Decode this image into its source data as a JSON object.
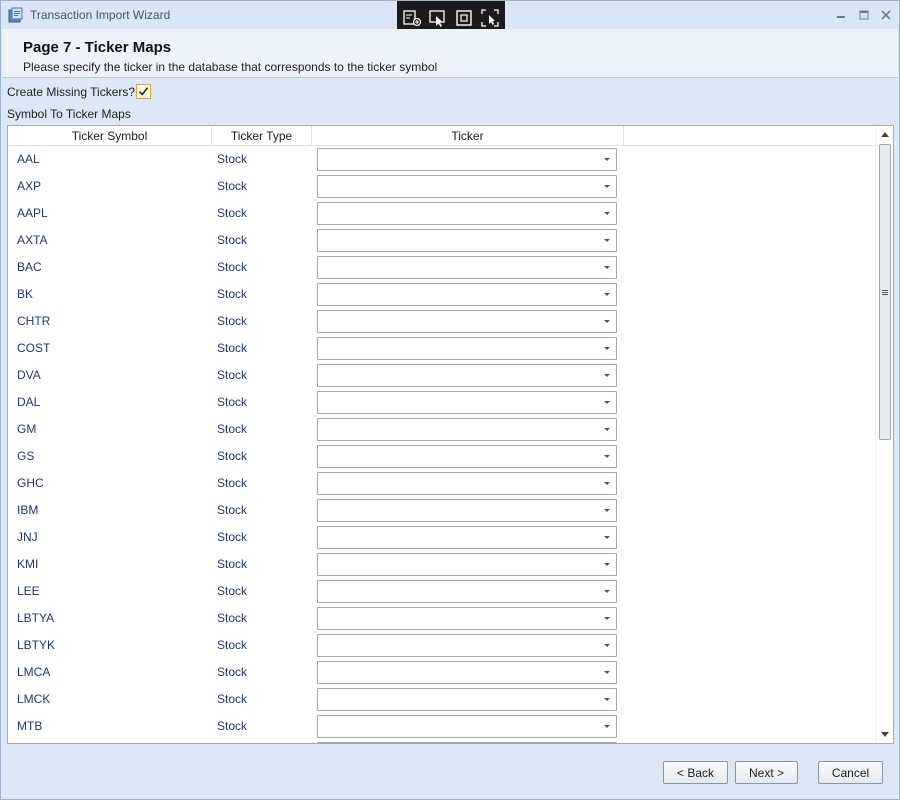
{
  "window": {
    "title": "Transaction Import Wizard",
    "app_icon": "wizard-app-icon",
    "controls": [
      "minimize-icon",
      "maximize-icon",
      "close-icon"
    ]
  },
  "floating_toolbar": {
    "icons": [
      "add-region-icon",
      "select-pointer-icon",
      "frame-icon",
      "screenshot-icon"
    ]
  },
  "header": {
    "title": "Page 7 - Ticker Maps",
    "subtitle": "Please specify the ticker in the database that corresponds to the ticker symbol"
  },
  "create_missing": {
    "label": "Create Missing Tickers?",
    "checked": true
  },
  "grid": {
    "section_label": "Symbol To Ticker Maps",
    "columns": [
      "Ticker Symbol",
      "Ticker Type",
      "Ticker"
    ],
    "rows": [
      {
        "symbol": "AAL",
        "type": "Stock",
        "ticker": ""
      },
      {
        "symbol": "AXP",
        "type": "Stock",
        "ticker": ""
      },
      {
        "symbol": "AAPL",
        "type": "Stock",
        "ticker": ""
      },
      {
        "symbol": "AXTA",
        "type": "Stock",
        "ticker": ""
      },
      {
        "symbol": "BAC",
        "type": "Stock",
        "ticker": ""
      },
      {
        "symbol": "BK",
        "type": "Stock",
        "ticker": ""
      },
      {
        "symbol": "CHTR",
        "type": "Stock",
        "ticker": ""
      },
      {
        "symbol": "COST",
        "type": "Stock",
        "ticker": ""
      },
      {
        "symbol": "DVA",
        "type": "Stock",
        "ticker": ""
      },
      {
        "symbol": "DAL",
        "type": "Stock",
        "ticker": ""
      },
      {
        "symbol": "GM",
        "type": "Stock",
        "ticker": ""
      },
      {
        "symbol": "GS",
        "type": "Stock",
        "ticker": ""
      },
      {
        "symbol": "GHC",
        "type": "Stock",
        "ticker": ""
      },
      {
        "symbol": "IBM",
        "type": "Stock",
        "ticker": ""
      },
      {
        "symbol": "JNJ",
        "type": "Stock",
        "ticker": ""
      },
      {
        "symbol": "KMI",
        "type": "Stock",
        "ticker": ""
      },
      {
        "symbol": "LEE",
        "type": "Stock",
        "ticker": ""
      },
      {
        "symbol": "LBTYA",
        "type": "Stock",
        "ticker": ""
      },
      {
        "symbol": "LBTYK",
        "type": "Stock",
        "ticker": ""
      },
      {
        "symbol": "LMCA",
        "type": "Stock",
        "ticker": ""
      },
      {
        "symbol": "LMCK",
        "type": "Stock",
        "ticker": ""
      },
      {
        "symbol": "MTB",
        "type": "Stock",
        "ticker": ""
      },
      {
        "symbol": "",
        "type": "",
        "ticker": ""
      }
    ]
  },
  "buttons": {
    "back": "< Back",
    "next": "Next >",
    "cancel": "Cancel"
  },
  "colors": {
    "window_bg": "#dce8f6",
    "header_bg": "#eef3fb",
    "cell_text": "#1e3a6e",
    "checkbox_border": "#d9a441"
  }
}
